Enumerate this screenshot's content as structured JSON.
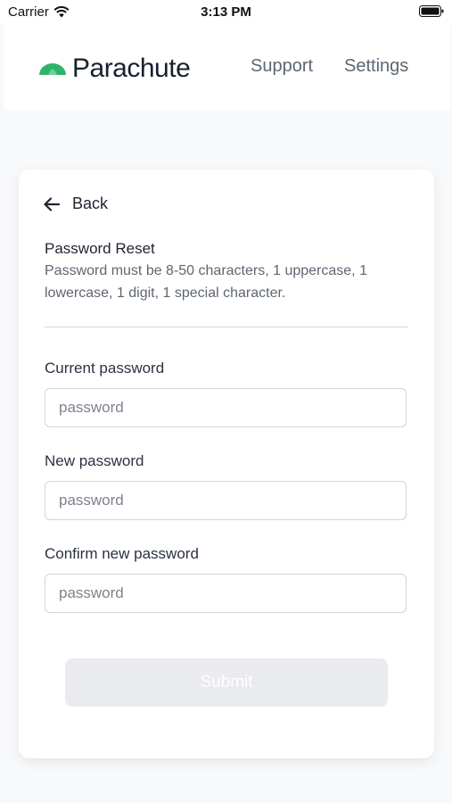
{
  "status_bar": {
    "carrier": "Carrier",
    "time": "3:13 PM"
  },
  "header": {
    "brand": "Parachute",
    "nav": {
      "support": "Support",
      "settings": "Settings"
    }
  },
  "card": {
    "back_label": "Back",
    "title": "Password Reset",
    "description": "Password must be 8-50 characters, 1 uppercase, 1 lowercase, 1 digit, 1 special character.",
    "fields": {
      "current": {
        "label": "Current password",
        "placeholder": "password",
        "value": ""
      },
      "new": {
        "label": "New password",
        "placeholder": "password",
        "value": ""
      },
      "confirm": {
        "label": "Confirm new password",
        "placeholder": "password",
        "value": ""
      }
    },
    "submit_label": "Submit"
  },
  "colors": {
    "brand_green": "#2fb36b",
    "submit_disabled_bg": "#e9ebee"
  }
}
